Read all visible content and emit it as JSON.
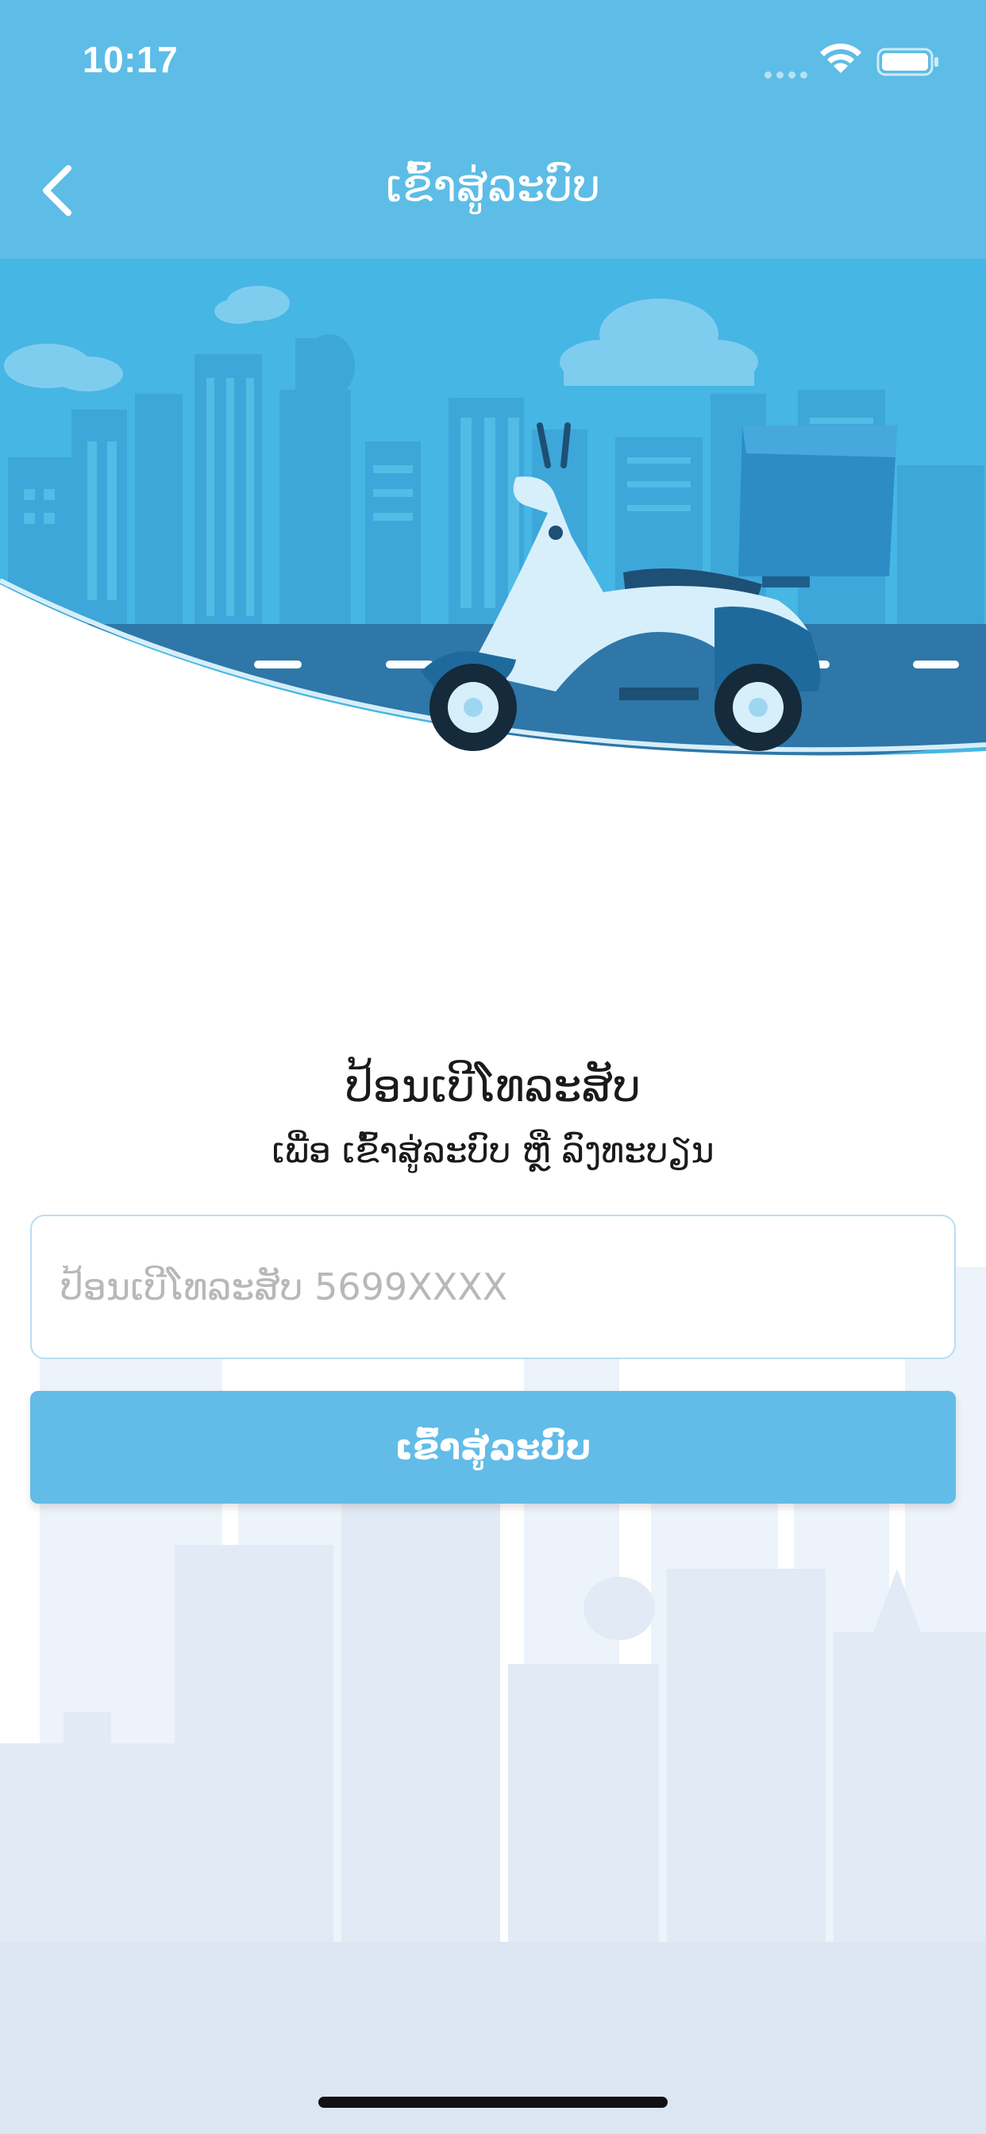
{
  "status_bar": {
    "time": "10:17",
    "wifi_icon": "wifi-icon",
    "battery_icon": "battery-icon"
  },
  "nav": {
    "back_icon": "chevron-left-icon",
    "title": "ເຂົ້າສູ່ລະບົບ"
  },
  "hero": {
    "illustration": "delivery-scooter-city"
  },
  "form": {
    "headline": "ປ້ອນເບີໂທລະສັບ",
    "subline": "ເພື່ອ ເຂົ້າສູ່ລະບົບ ຫຼື ລົງທະບຽນ",
    "phone_input": {
      "value": "",
      "placeholder": "ປ້ອນເບີໂທລະສັບ 5699XXXX"
    },
    "login_button_label": "ເຂົ້າສູ່ລະບົບ"
  },
  "colors": {
    "primary": "#5dbde6",
    "button": "#62bce7",
    "input_border": "#b9dcf2",
    "road": "#2e77a8"
  }
}
